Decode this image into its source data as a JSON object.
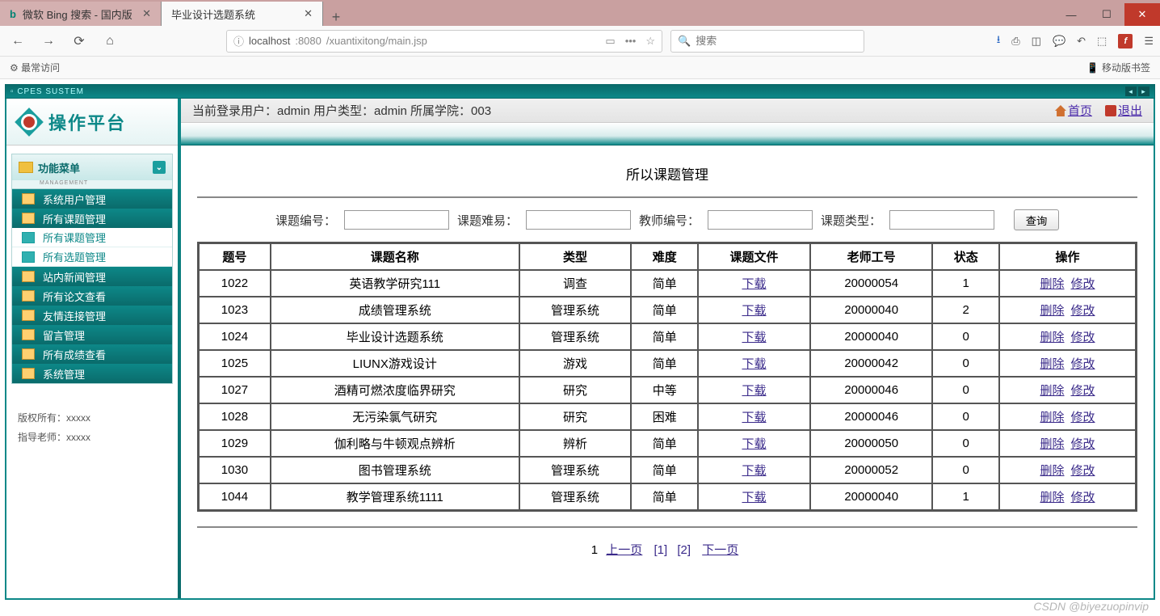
{
  "browser": {
    "tabs": [
      {
        "title": "微软 Bing 搜索 - 国内版",
        "active": false
      },
      {
        "title": "毕业设计选题系统",
        "active": true
      }
    ],
    "url_host": "localhost",
    "url_port": ":8080",
    "url_path": "/xuantixitong/main.jsp",
    "search_placeholder": "搜索",
    "bookmark_left": "最常访问",
    "bookmark_right": "移动版书签"
  },
  "app": {
    "title_bar": "CPES  SUSTEM",
    "logo_text": "操作平台",
    "menu_title": "功能菜单",
    "menu_sub": "MANAGEMENT",
    "menu_items": [
      {
        "label": "系统用户管理",
        "style": "dark"
      },
      {
        "label": "所有课题管理",
        "style": "dark"
      },
      {
        "label": "所有课题管理",
        "style": "light"
      },
      {
        "label": "所有选题管理",
        "style": "light"
      },
      {
        "label": "站内新闻管理",
        "style": "dark"
      },
      {
        "label": "所有论文查看",
        "style": "dark"
      },
      {
        "label": "友情连接管理",
        "style": "dark"
      },
      {
        "label": "留言管理",
        "style": "dark"
      },
      {
        "label": "所有成绩查看",
        "style": "dark"
      },
      {
        "label": "系统管理",
        "style": "dark"
      }
    ],
    "footer_copyright": "版权所有：xxxxx",
    "footer_advisor": "指导老师：xxxxx"
  },
  "header": {
    "info": "当前登录用户：admin   用户类型：admin   所属学院：003",
    "home": "首页",
    "exit": "退出"
  },
  "page": {
    "title": "所以课题管理",
    "search": {
      "f1": "课题编号：",
      "f2": "课题难易：",
      "f3": "教师编号：",
      "f4": "课题类型：",
      "btn": "查询"
    },
    "columns": [
      "题号",
      "课题名称",
      "类型",
      "难度",
      "课题文件",
      "老师工号",
      "状态",
      "操作"
    ],
    "download_label": "下载",
    "op_delete": "删除",
    "op_edit": "修改",
    "rows": [
      {
        "id": "1022",
        "name": "英语教学研究111",
        "type": "调查",
        "diff": "简单",
        "teacher": "20000054",
        "status": "1"
      },
      {
        "id": "1023",
        "name": "成绩管理系统",
        "type": "管理系统",
        "diff": "简单",
        "teacher": "20000040",
        "status": "2"
      },
      {
        "id": "1024",
        "name": "毕业设计选题系统",
        "type": "管理系统",
        "diff": "简单",
        "teacher": "20000040",
        "status": "0"
      },
      {
        "id": "1025",
        "name": "LIUNX游戏设计",
        "type": "游戏",
        "diff": "简单",
        "teacher": "20000042",
        "status": "0"
      },
      {
        "id": "1027",
        "name": "酒精可燃浓度临界研究",
        "type": "研究",
        "diff": "中等",
        "teacher": "20000046",
        "status": "0"
      },
      {
        "id": "1028",
        "name": "无污染氯气研究",
        "type": "研究",
        "diff": "困难",
        "teacher": "20000046",
        "status": "0"
      },
      {
        "id": "1029",
        "name": "伽利略与牛顿观点辨析",
        "type": "辨析",
        "diff": "简单",
        "teacher": "20000050",
        "status": "0"
      },
      {
        "id": "1030",
        "name": "图书管理系统",
        "type": "管理系统",
        "diff": "简单",
        "teacher": "20000052",
        "status": "0"
      },
      {
        "id": "1044",
        "name": "教学管理系统1111",
        "type": "管理系统",
        "diff": "简单",
        "teacher": "20000040",
        "status": "1"
      }
    ],
    "pager": {
      "total": "1",
      "prev": "上一页",
      "p1": "[1]",
      "p2": "[2]",
      "next": "下一页"
    }
  },
  "watermark": "CSDN @biyezuopinvip"
}
